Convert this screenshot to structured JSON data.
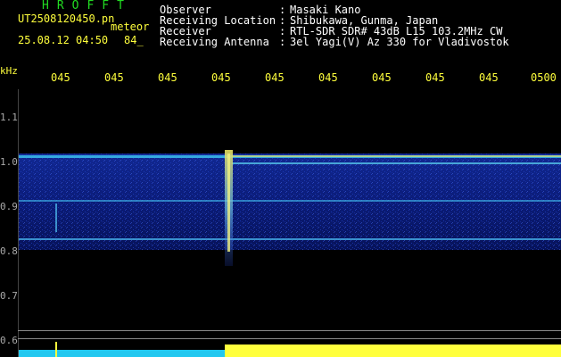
{
  "header": {
    "brand": "HROFFT",
    "file_name": "UT2508120450.pn",
    "tag": "meteor",
    "date_time": "25.08.12 04:50",
    "counter": "84_"
  },
  "meta": [
    {
      "label": "Observer",
      "value": "Masaki Kano"
    },
    {
      "label": "Receiving Location",
      "value": "Shibukawa, Gunma, Japan"
    },
    {
      "label": "Receiver",
      "value": "RTL-SDR SDR# 43dB L15 103.2MHz CW"
    },
    {
      "label": "Receiving Antenna",
      "value": "3el Yagi(V) Az 330 for Vladivostok"
    }
  ],
  "meta_colon": ":",
  "axis": {
    "unit": "kHz",
    "freq_labels": [
      "1.1",
      "1.0",
      "0.9",
      "0.8",
      "0.7",
      "0.6"
    ],
    "time_labels": [
      "045",
      "045",
      "045",
      "045",
      "045",
      "045",
      "045",
      "045",
      "045",
      "0500"
    ]
  },
  "colors": {
    "yellow": "#ffff3c",
    "green": "#22dd22",
    "white": "#ffffff",
    "spectrogram_blue": "#1a2ca8"
  }
}
